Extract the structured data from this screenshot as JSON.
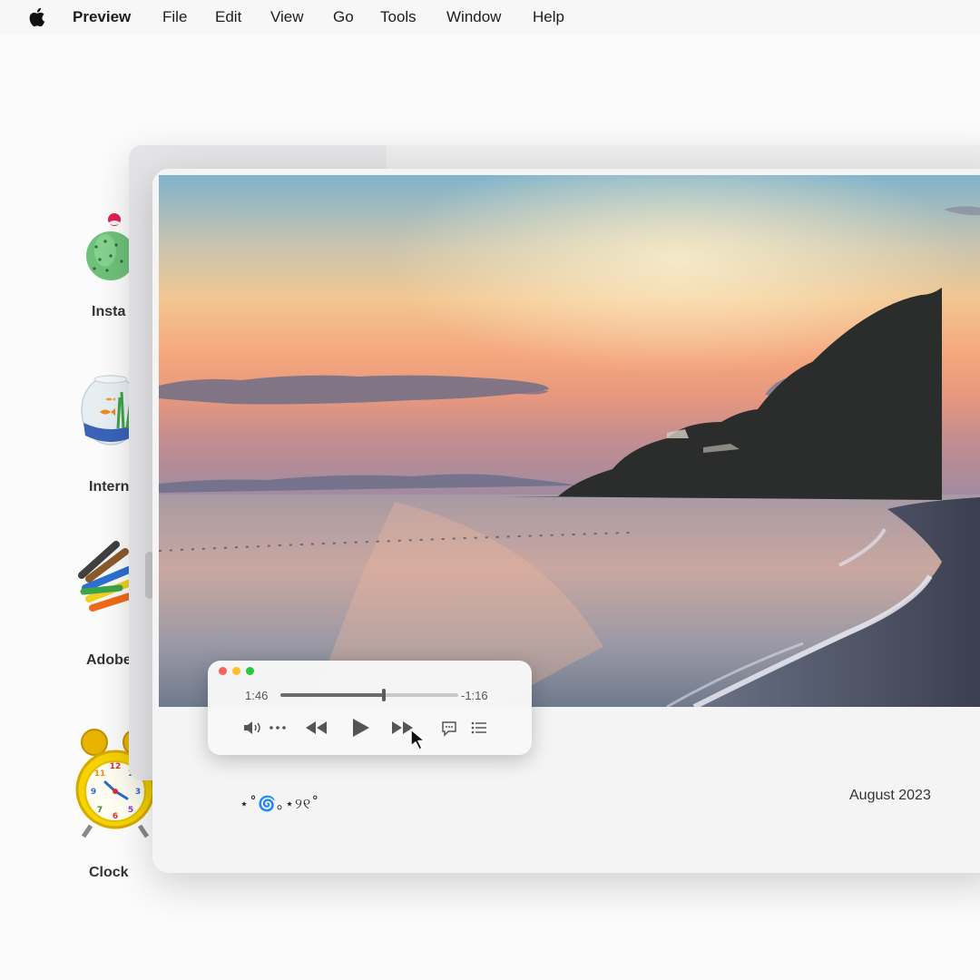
{
  "menubar": {
    "apple_icon": "apple-logo-icon",
    "app_name": "Preview",
    "items": [
      "File",
      "Edit",
      "View",
      "Go",
      "Tools",
      "Window",
      "Help"
    ]
  },
  "desktop": {
    "icons": [
      {
        "label": "Insta",
        "icon": "cactus-installer-icon"
      },
      {
        "label": "Intern",
        "icon": "fishbowl-internet-icon"
      },
      {
        "label": "Adobe",
        "icon": "crayons-icon"
      },
      {
        "label": "Clock",
        "icon": "alarm-clock-icon"
      }
    ]
  },
  "card": {
    "photo": "sunset-beach-photo",
    "caption": "⋆˚🌀｡⋆୨୧˚",
    "date": "August 2023"
  },
  "player": {
    "elapsed": "1:46",
    "remaining": "-1:16",
    "progress": 0.58,
    "controls": [
      "volume-icon",
      "more-icon",
      "rewind-icon",
      "play-icon",
      "fast-forward-icon",
      "subtitles-icon",
      "chapters-list-icon"
    ]
  },
  "colors": {
    "close": "#fe5f57",
    "minimize": "#febc2e",
    "zoom": "#28c840"
  }
}
